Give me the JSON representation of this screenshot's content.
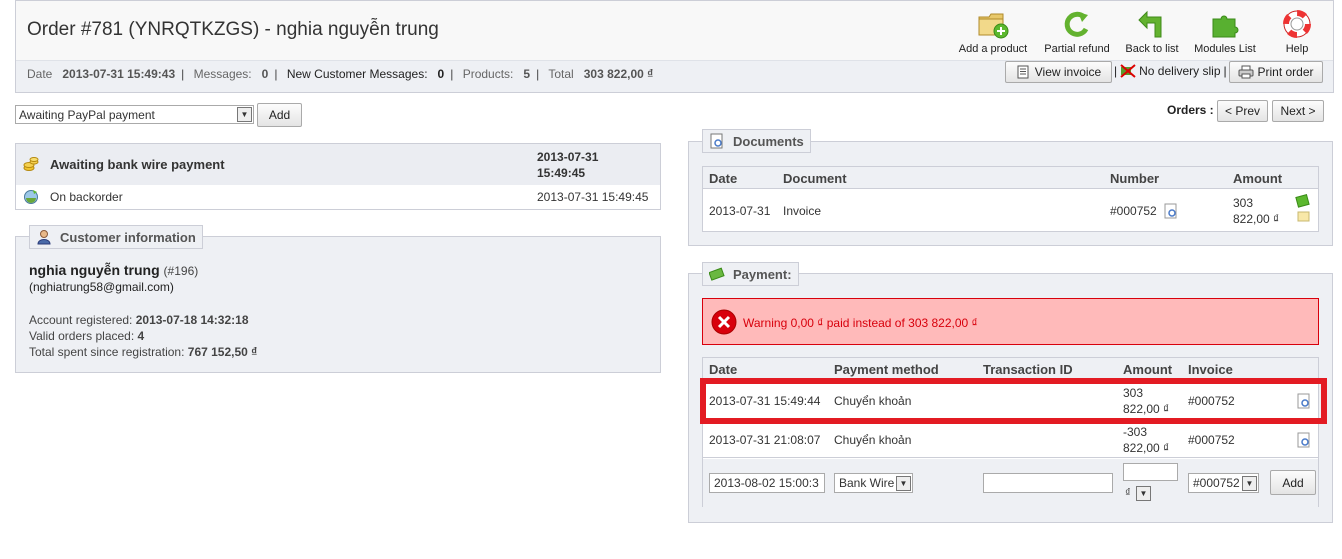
{
  "header": {
    "title": "Order #781 (YNRQTKZGS) - nghia nguyễn trung",
    "toolbar": {
      "add_product": "Add a product",
      "partial_refund": "Partial refund",
      "back_to_list": "Back to list",
      "modules_list": "Modules List",
      "help": "Help"
    },
    "meta": {
      "date_label": "Date",
      "date_value": "2013-07-31 15:49:43",
      "messages_label": "Messages:",
      "messages_value": "0",
      "new_messages_label": "New Customer Messages:",
      "new_messages_value": "0",
      "products_label": "Products:",
      "products_value": "5",
      "total_label": "Total",
      "total_value": "303 822,00 ₫"
    },
    "actions": {
      "view_invoice": "View invoice",
      "no_delivery_slip": "No delivery slip",
      "print_order": "Print order"
    }
  },
  "status_form": {
    "selected_status": "Awaiting PayPal payment",
    "add_label": "Add"
  },
  "order_nav": {
    "orders_label": "Orders :",
    "prev_label": "< Prev",
    "next_label": "Next >"
  },
  "history": [
    {
      "status": "Awaiting bank wire payment",
      "date": "2013-07-31 15:49:45"
    },
    {
      "status": "On backorder",
      "date": "2013-07-31 15:49:45"
    }
  ],
  "customer": {
    "legend": "Customer information",
    "name": "nghia nguyễn trung",
    "id": "(#196)",
    "email": "(nghiatrung58@gmail.com)",
    "registered_label": "Account registered:",
    "registered_value": "2013-07-18 14:32:18",
    "valid_orders_label": "Valid orders placed:",
    "valid_orders_value": "4",
    "total_spent_label": "Total spent since registration:",
    "total_spent_value": "767 152,50 ₫"
  },
  "documents": {
    "legend": "Documents",
    "headers": {
      "date": "Date",
      "document": "Document",
      "number": "Number",
      "amount": "Amount"
    },
    "rows": [
      {
        "date": "2013-07-31",
        "document": "Invoice",
        "number": "#000752",
        "amount_line1": "303",
        "amount_line2": "822,00 ₫"
      }
    ]
  },
  "payment": {
    "legend": "Payment:",
    "warning": "Warning 0,00 ₫ paid instead of 303 822,00 ₫",
    "headers": {
      "date": "Date",
      "method": "Payment method",
      "transaction": "Transaction ID",
      "amount": "Amount",
      "invoice": "Invoice"
    },
    "rows": [
      {
        "date": "2013-07-31 15:49:44",
        "method": "Chuyển khoản",
        "amount_line1": "303",
        "amount_line2": "822,00 ₫",
        "invoice": "#000752"
      },
      {
        "date": "2013-07-31 21:08:07",
        "method": "Chuyển khoản",
        "amount_line1": "-303",
        "amount_line2": "822,00 ₫",
        "invoice": "#000752"
      }
    ],
    "form": {
      "date_value": "2013-08-02 15:00:3",
      "method_value": "Bank Wire",
      "transaction_value": "",
      "amount_value": "",
      "currency_value": "₫",
      "invoice_value": "#000752",
      "add_label": "Add"
    }
  },
  "colors": {
    "highlight": "#e31b23",
    "warning_bg": "#ffbaba",
    "warning_border": "#d8000c"
  }
}
